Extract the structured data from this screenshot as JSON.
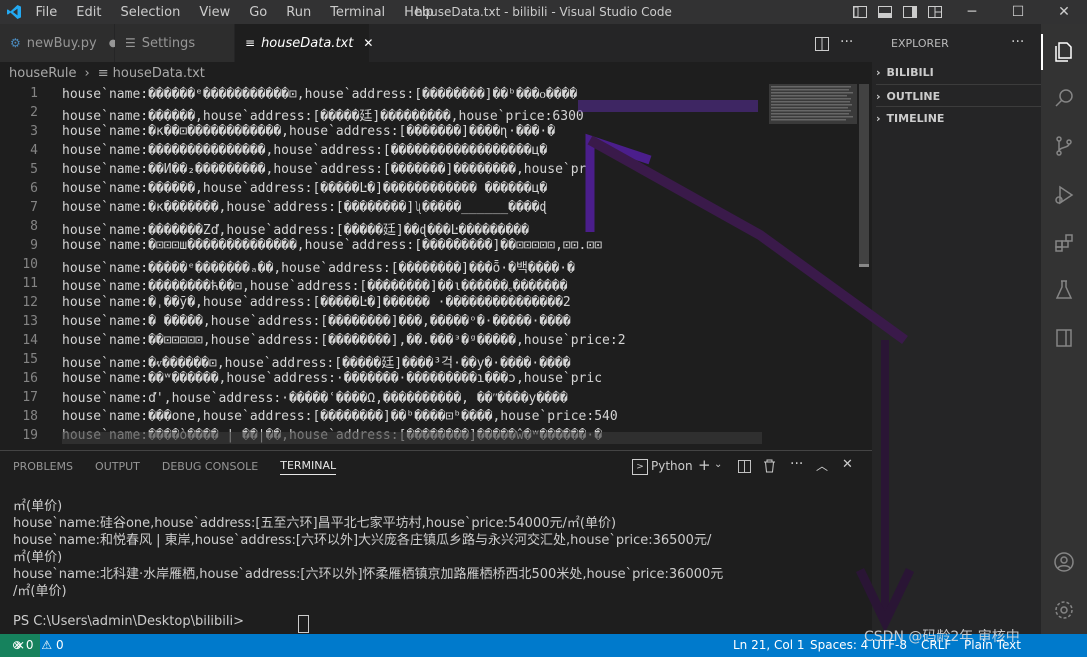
{
  "titlebar": {
    "menu": [
      "File",
      "Edit",
      "Selection",
      "View",
      "Go",
      "Run",
      "Terminal",
      "Help"
    ],
    "window_title": "houseData.txt - bilibili - Visual Studio Code"
  },
  "tabs": [
    {
      "label": "newBuy.py",
      "icon": "python-file-icon",
      "modified": true
    },
    {
      "label": "Settings",
      "icon": "settings-icon"
    },
    {
      "label": "houseData.txt",
      "icon": "text-file-icon",
      "active": true
    }
  ],
  "breadcrumb": {
    "folder": "houseRule",
    "file": "houseData.txt"
  },
  "editor": {
    "lines": [
      {
        "n": "1",
        "text": "house`name:������ᵉ�����������⊡,house`address:[��������]��ᵇ���ᴏ����"
      },
      {
        "n": "2",
        "text": "house`name:������,house`address:[�����廷]���������,house`price:6300"
      },
      {
        "n": "3",
        "text": "house`name:�к��⊡������������,house`address:[�������]����ɳ·���·�"
      },
      {
        "n": "4",
        "text": "house`name:���������������,house`address:[������������������ц�"
      },
      {
        "n": "5",
        "text": "house`name:��И��₂���������,house`address:[�������]��������,house`pr"
      },
      {
        "n": "6",
        "text": "house`name:������,house`address:[�����Ŀ�]������������ ������ц�"
      },
      {
        "n": "7",
        "text": "house`name:�к�������,house`address:[��������]ʯ�����______����ɖ"
      },
      {
        "n": "8",
        "text": "house`name:�������Zď,house`address:[�����廷]��ɖ���Ŀ���������"
      },
      {
        "n": "9",
        "text": "house`name:�⊡⊡⊡ш��������������,house`address:[���������]��⊡⊡⊡⊡⊡,⊡⊡.⊡⊡"
      },
      {
        "n": "10",
        "text": "house`name:�����ᵉ�������ₐ��,house`address:[��������]���ȭ·�백����·�"
      },
      {
        "n": "11",
        "text": "house`name:��������ћ��⊡,house`address:[��������]��ι������꜀�������"
      },
      {
        "n": "12",
        "text": "house`name:�ˌ��ӯ�,house`address:[�����Ŀ�]������ ·���������������2"
      },
      {
        "n": "13",
        "text": "house`name:� �����,house`address:[��������]���,�����ᵒ�·�����·����"
      },
      {
        "n": "14",
        "text": "house`name:��⊡⊡⊡⊡⊡,house`address:[��������],��.���ᵌ�ᵍ�����,house`price:2"
      },
      {
        "n": "15",
        "text": "house`name:�ⱴ������⊡,house`address:[�����廷]����³걱·��у�·����·����"
      },
      {
        "n": "16",
        "text": "house`name:��ʷ������,house`address:·�������·���������ɿ���ɔ,house`pric"
      },
      {
        "n": "17",
        "text": "house`name:ď',house`address:·�����ʿ����Ω,����������, ��ʺ����у����"
      },
      {
        "n": "18",
        "text": "house`name:���one,house`address:[��������]��ᵇ����⊡ᵇ����,house`price:540"
      },
      {
        "n": "19",
        "text": "house`name:����ò���� | ��|��,house`address:[��������]�����ŵ�ʷ������·�"
      }
    ]
  },
  "explorer": {
    "header": "EXPLORER",
    "sections": [
      "BILIBILI",
      "OUTLINE",
      "TIMELINE"
    ]
  },
  "panel": {
    "tabs": [
      "PROBLEMS",
      "OUTPUT",
      "DEBUG CONSOLE",
      "TERMINAL"
    ],
    "active_tab": "TERMINAL",
    "shell": "Python",
    "terminal_lines": [
      "㎡(单价)",
      "house`name:硅谷one,house`address:[五至六环]昌平北七家平坊村,house`price:54000元/㎡(单价)",
      "house`name:和悦春风 | 東岸,house`address:[六环以外]大兴庞各庄镇瓜乡路与永兴河交汇处,house`price:36500元/",
      "㎡(单价)",
      "house`name:北科建·水岸雁栖,house`address:[六环以外]怀柔雁栖镇京加路雁栖桥西北500米处,house`price:36000元",
      "/㎡(单价)",
      "",
      "PS C:\\Users\\admin\\Desktop\\bilibili> "
    ]
  },
  "statusbar": {
    "errors": "0",
    "warnings": "0",
    "position": "Ln 21, Col 1",
    "spaces": "Spaces: 4",
    "encoding": "UTF-8",
    "eol": "CRLF",
    "language": "Plain Text"
  },
  "watermark": "CSDN @码龄2年 审核中",
  "colors": {
    "statusbar": "#007acc",
    "annotation": "#3a1a4a",
    "highlight": "#5a2d9c"
  }
}
